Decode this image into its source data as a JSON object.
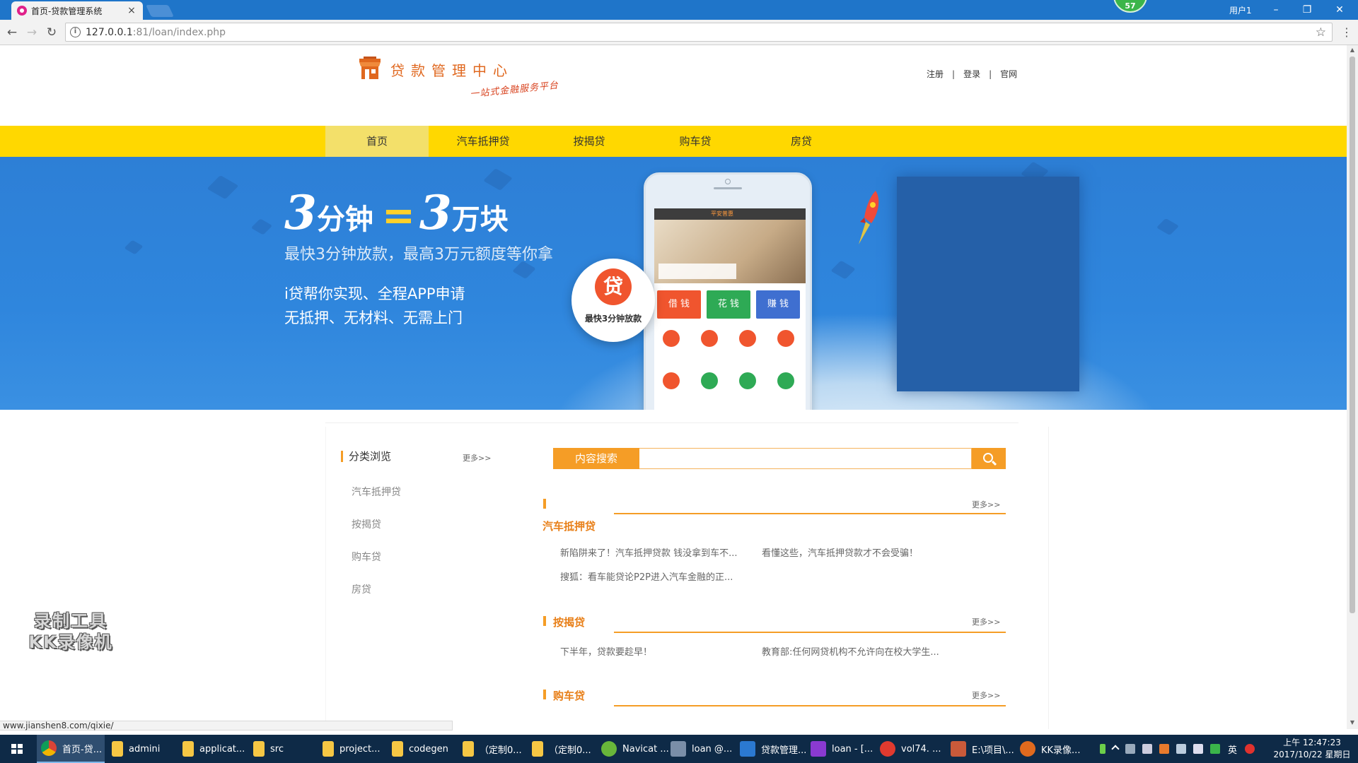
{
  "browser": {
    "tab_title": "首页-贷款管理系统",
    "tab_close": "×",
    "badge_number": "57",
    "user_name": "用户1",
    "url_host": "127.0.0.1",
    "url_port_path": ":81/loan/index.php",
    "status_url": "www.jianshen8.com/qixie/",
    "win_minimize": "–",
    "win_restore": "❐",
    "win_close": "✕",
    "back_glyph": "←",
    "forward_glyph": "→",
    "reload_glyph": "↻",
    "star_glyph": "☆",
    "menu_glyph": "⋮",
    "info_glyph": "i",
    "scroll_up": "▲",
    "scroll_down": "▼"
  },
  "header": {
    "logo_title": "贷款管理中心",
    "logo_slogan": "一站式金融服务平台",
    "links": [
      "注册",
      "登录",
      "官网"
    ],
    "separator": "|"
  },
  "nav": {
    "items": [
      "首页",
      "汽车抵押贷",
      "按揭贷",
      "购车贷",
      "房贷"
    ],
    "active_index": 0
  },
  "banner": {
    "headline_num1": "3",
    "headline_word1": "分钟",
    "headline_eq": "=",
    "headline_num2": "3",
    "headline_word2": "万块",
    "subline": "最快3分钟放款，最高3万元额度等你拿",
    "line1": "i贷帮你实现、全程APP申请",
    "line2": "无抵押、无材料、无需上门",
    "badge_glyph": "贷",
    "badge_text": "最快3分钟放款",
    "phone_buttons": [
      "借 钱",
      "花 钱",
      "赚 钱"
    ],
    "phone_brand": "平安普惠",
    "cursor_glyph": "☝"
  },
  "sidebar": {
    "title": "分类浏览",
    "more": "更多>>",
    "items": [
      "汽车抵押贷",
      "按揭贷",
      "购车贷",
      "房贷"
    ]
  },
  "search": {
    "label": "内容搜索",
    "placeholder": ""
  },
  "sections": [
    {
      "title": "汽车抵押贷",
      "more": "更多>>",
      "articles": [
        "新陷阱来了！汽车抵押贷款 钱没拿到车不...",
        "看懂这些，汽车抵押贷款才不会受骗！",
        "搜狐：看车能贷论P2P进入汽车金融的正..."
      ]
    },
    {
      "title": "按揭贷",
      "more": "更多>>",
      "articles": [
        "下半年，贷款要趁早！",
        "教育部:任何网贷机构不允许向在校大学生..."
      ]
    },
    {
      "title": "购车贷",
      "more": "更多>>",
      "articles": []
    }
  ],
  "watermark": {
    "line1": "录制工具",
    "line2": "KK录像机"
  },
  "taskbar": {
    "items": [
      "首页-贷...",
      "admini",
      "applicat...",
      "src",
      "project...",
      "codegen",
      "（定制0...",
      "（定制0...",
      "Navicat ...",
      "loan @...",
      "贷款管理...",
      "loan - [...",
      "vol74. ...",
      "E:\\项目\\...",
      "KK录像..."
    ],
    "ime": "英",
    "time": "上午 12:47:23",
    "date": "2017/10/22 星期日"
  },
  "colors": {
    "nav_yellow": "#ffd800",
    "accent_orange": "#f59d26",
    "banner_blue": "#2f86dd",
    "browser_blue": "#1f75c9",
    "taskbar": "#0e2a47"
  }
}
